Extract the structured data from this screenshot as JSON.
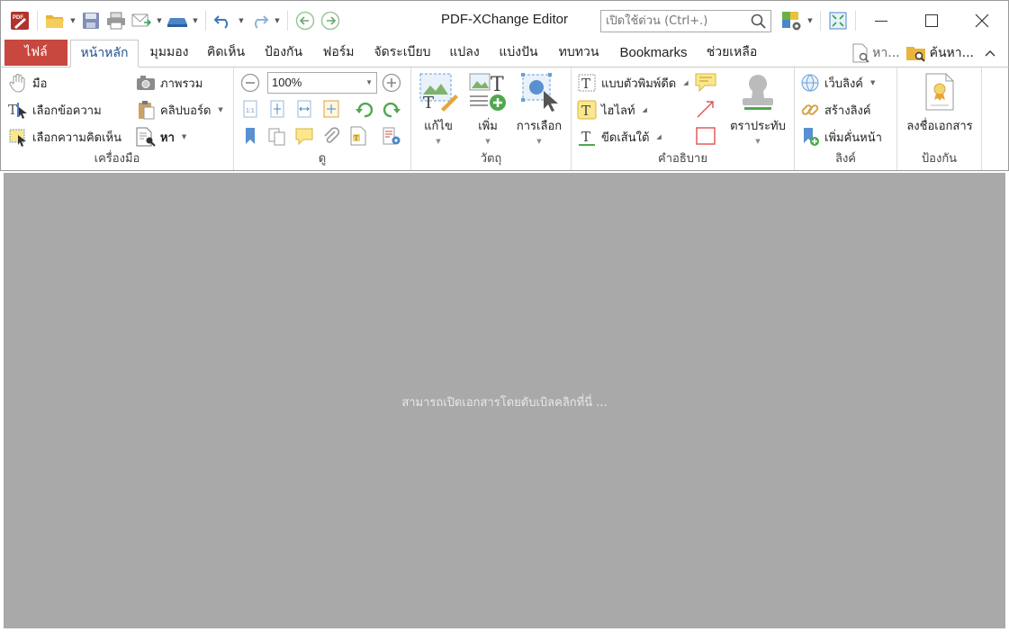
{
  "app": {
    "title": "PDF-XChange Editor",
    "quick_find_placeholder": "เปิดใช้ด่วน (Ctrl+.)"
  },
  "tabs": [
    {
      "label": "ไฟล์"
    },
    {
      "label": "หน้าหลัก"
    },
    {
      "label": "มุมมอง"
    },
    {
      "label": "คิดเห็น"
    },
    {
      "label": "ป้องกัน"
    },
    {
      "label": "ฟอร์ม"
    },
    {
      "label": "จัดระเบียบ"
    },
    {
      "label": "แปลง"
    },
    {
      "label": "แบ่งปัน"
    },
    {
      "label": "ทบทวน"
    },
    {
      "label": "Bookmarks"
    },
    {
      "label": "ช่วยเหลือ"
    }
  ],
  "tabbar_right": {
    "find_label": "หา...",
    "search_label": "ค้นหา..."
  },
  "groups": {
    "tools": {
      "label": "เครื่องมือ",
      "hand": "มือ",
      "select_text": "เลือกข้อความ",
      "select_comments": "เลือกความคิดเห็น",
      "snapshot": "ภาพรวม",
      "clipboard": "คลิปบอร์ด",
      "find": "หา"
    },
    "view": {
      "label": "ดู",
      "zoom_value": "100%"
    },
    "objects": {
      "label": "วัตถุ",
      "edit": "แก้ไข",
      "add": "เพิ่ม",
      "select": "การเลือก"
    },
    "comments": {
      "label": "คำอธิบาย",
      "typewriter": "แบบตัวพิมพ์ดีด",
      "highlight": "ไฮไลท์",
      "underline": "ขีดเส้นใต้",
      "stamp": "ตราประทับ"
    },
    "links": {
      "label": "ลิงค์",
      "weblinks": "เว็บลิงค์",
      "create_link": "สร้างลิงค์",
      "add_bookmark": "เพิ่มคั่นหน้า"
    },
    "protect": {
      "label": "ป้องกัน",
      "sign": "ลงชื่อเอกสาร"
    }
  },
  "document": {
    "hint": "สามารถเปิดเอกสารโดยดับเบิลคลิกที่นี่ ..."
  },
  "colors": {
    "file_tab": "#c8473f",
    "active_tab_text": "#1f4f8c",
    "doc_background": "#a9a9a9"
  }
}
